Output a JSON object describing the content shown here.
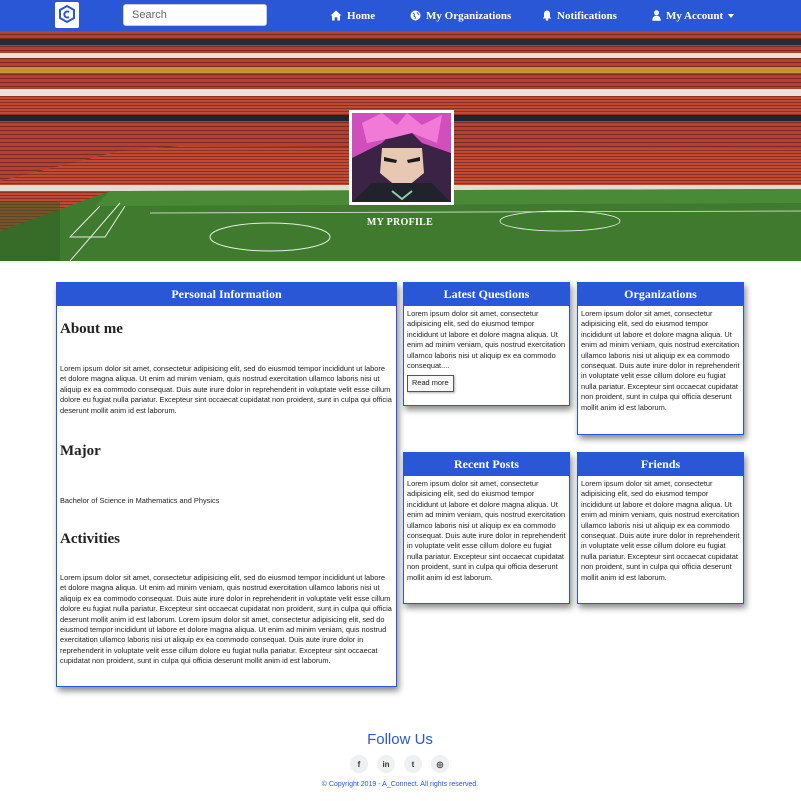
{
  "nav": {
    "search_placeholder": "Search",
    "home": "Home",
    "organizations": "My Organizations",
    "notifications": "Notifications",
    "account": "My Account"
  },
  "hero": {
    "title": "MY PROFILE"
  },
  "personal": {
    "header": "Personal Information",
    "about_title": "About me",
    "about_text": "Lorem ipsum dolor sit amet, consectetur adipisicing elit, sed do eiusmod tempor incididunt ut labore et dolore magna aliqua. Ut enim ad minim veniam, quis nostrud exercitation ullamco laboris nisi ut aliquip ex ea commodo consequat. Duis aute irure dolor in reprehenderit in voluptate velit esse cillum dolore eu fugiat nulla pariatur. Excepteur sint occaecat cupidatat non proident, sunt in culpa qui officia deserunt mollit anim id est laborum.",
    "major_title": "Major",
    "major_text": "Bachelor of Science in Mathematics and Physics",
    "activities_title": "Activities",
    "activities_text": "Lorem ipsum dolor sit amet, consectetur adipisicing elit, sed do eiusmod tempor incididunt ut labore et dolore magna aliqua. Ut enim ad minim veniam, quis nostrud exercitation ullamco laboris nisi ut aliquip ex ea commodo consequat. Duis aute irure dolor in reprehenderit in voluptate velit esse cillum dolore eu fugiat nulla pariatur. Excepteur sint occaecat cupidatat non proident, sunt in culpa qui officia deserunt mollit anim id est laborum. Lorem ipsum dolor sit amet, consectetur adipisicing elit, sed do eiusmod tempor incididunt ut labore et dolore magna aliqua. Ut enim ad minim veniam, quis nostrud exercitation ullamco laboris nisi ut aliquip ex ea commodo consequat. Duis aute irure dolor in reprehenderit in voluptate velit esse cillum dolore eu fugiat nulla pariatur. Excepteur sint occaecat cupidatat non proident, sunt in culpa qui officia deserunt mollit anim id est laborum."
  },
  "questions": {
    "header": "Latest Questions",
    "text": "Lorem ipsum dolor sit amet, consectetur adipisicing elit, sed do eiusmod tempor incididunt ut labore et dolore magna aliqua. Ut enim ad minim veniam, quis nostrud exercitation ullamco laboris nisi ut aliquip ex ea commodo consequat....",
    "read_more": "Read more"
  },
  "organizations": {
    "header": "Organizations",
    "text": "Lorem ipsum dolor sit amet, consectetur adipisicing elit, sed do eiusmod tempor incididunt ut labore et dolore magna aliqua. Ut enim ad minim veniam, quis nostrud exercitation ullamco laboris nisi ut aliquip ex ea commodo consequat. Duis aute irure dolor in reprehenderit in voluptate velit esse cillum dolore eu fugiat nulla pariatur. Excepteur sint occaecat cupidatat non proident, sunt in culpa qui officia deserunt mollit anim id est laborum."
  },
  "posts": {
    "header": "Recent Posts",
    "text": "Lorem ipsum dolor sit amet, consectetur adipisicing elit, sed do eiusmod tempor incididunt ut labore et dolore magna aliqua. Ut enim ad minim veniam, quis nostrud exercitation ullamco laboris nisi ut aliquip ex ea commodo consequat. Duis aute irure dolor in reprehenderit in voluptate velit esse cillum dolore eu fugiat nulla pariatur. Excepteur sint occaecat cupidatat non proident, sunt in culpa qui officia deserunt mollit anim id est laborum."
  },
  "friends": {
    "header": "Friends",
    "text": "Lorem ipsum dolor sit amet, consectetur adipisicing elit, sed do eiusmod tempor incididunt ut labore et dolore magna aliqua. Ut enim ad minim veniam, quis nostrud exercitation ullamco laboris nisi ut aliquip ex ea commodo consequat. Duis aute irure dolor in reprehenderit in voluptate velit esse cillum dolore eu fugiat nulla pariatur. Excepteur sint occaecat cupidatat non proident, sunt in culpa qui officia deserunt mollit anim id est laborum."
  },
  "footer": {
    "follow": "Follow Us",
    "social": [
      {
        "icon": "facebook-icon",
        "glyph": "f"
      },
      {
        "icon": "linkedin-icon",
        "glyph": "in"
      },
      {
        "icon": "twitter-icon",
        "glyph": "t"
      },
      {
        "icon": "instagram-icon",
        "glyph": "◎"
      }
    ],
    "copyright": "© Copyright 2019 - A_Connect. All rights reserved."
  },
  "colors": {
    "brand": "#2a57d6",
    "field": "#3f7a2e",
    "stands": "#b5402e"
  }
}
